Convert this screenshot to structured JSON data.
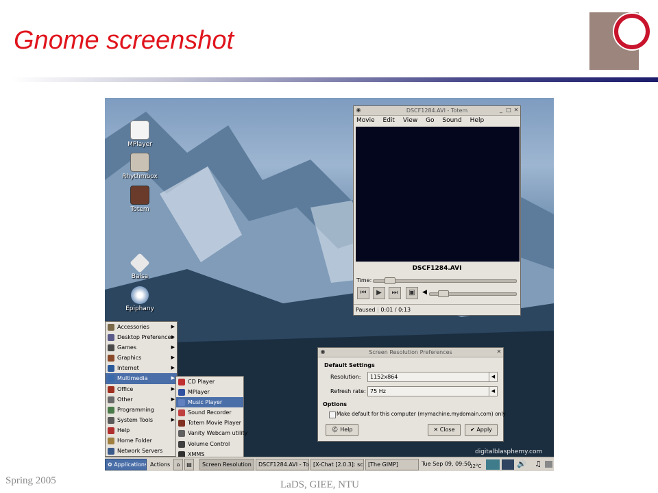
{
  "slide": {
    "title": "Gnome screenshot",
    "footer_left": "Spring 2005",
    "footer_center": "LaDS, GIEE, NTU",
    "accent_color": "#e0141c"
  },
  "desktop": {
    "watermark": "digitalblasphemy.com",
    "icons": [
      {
        "label": "MPlayer",
        "icon": "mplayer-icon"
      },
      {
        "label": "Rhythmbox",
        "icon": "rhythmbox-icon"
      },
      {
        "label": "Totem",
        "icon": "totem-icon"
      },
      {
        "label": "Balsa",
        "icon": "balsa-icon"
      },
      {
        "label": "Epiphany",
        "icon": "epiphany-icon"
      }
    ]
  },
  "totem": {
    "title": "DSCF1284.AVI - Totem",
    "menu": [
      "Movie",
      "Edit",
      "View",
      "Go",
      "Sound",
      "Help"
    ],
    "filename": "DSCF1284.AVI",
    "time_label": "Time:",
    "status": "Paused",
    "time": "0:01 / 0:13",
    "seek_fraction": 0.08,
    "volume_fraction": 0.1
  },
  "resolution_dialog": {
    "title": "Screen Resolution Preferences",
    "section_default": "Default Settings",
    "resolution_label": "Resolution:",
    "resolution_value": "1152x864",
    "refresh_label": "Refresh rate:",
    "refresh_value": "75 Hz",
    "section_options": "Options",
    "checkbox_label": "Make default for this computer (mymachine.mydomain.com) only",
    "help_label": "Help",
    "close_label": "Close",
    "apply_label": "Apply"
  },
  "app_menu": {
    "items": [
      {
        "label": "Accessories",
        "icon": "accessories-icon",
        "submenu": true
      },
      {
        "label": "Desktop Preferences",
        "icon": "desktop-preferences-icon",
        "submenu": true
      },
      {
        "label": "Games",
        "icon": "games-icon",
        "submenu": true
      },
      {
        "label": "Graphics",
        "icon": "graphics-icon",
        "submenu": true
      },
      {
        "label": "Internet",
        "icon": "internet-icon",
        "submenu": true
      },
      {
        "label": "Multimedia",
        "icon": "multimedia-icon",
        "submenu": true,
        "selected": true
      },
      {
        "label": "Office",
        "icon": "office-icon",
        "submenu": true
      },
      {
        "label": "Other",
        "icon": "other-icon",
        "submenu": true
      },
      {
        "label": "Programming",
        "icon": "programming-icon",
        "submenu": true
      },
      {
        "label": "System Tools",
        "icon": "system-tools-icon",
        "submenu": true
      },
      {
        "label": "Help",
        "icon": "help-icon",
        "submenu": false
      },
      {
        "label": "Home Folder",
        "icon": "home-folder-icon",
        "submenu": false
      },
      {
        "label": "Network Servers",
        "icon": "network-servers-icon",
        "submenu": false
      }
    ]
  },
  "multimedia_menu": {
    "items": [
      {
        "label": "CD Player",
        "icon": "cd-player-icon"
      },
      {
        "label": "MPlayer",
        "icon": "mplayer-icon"
      },
      {
        "label": "Music Player",
        "icon": "music-player-icon",
        "selected": true
      },
      {
        "label": "Sound Recorder",
        "icon": "sound-recorder-icon"
      },
      {
        "label": "Totem Movie Player",
        "icon": "totem-icon"
      },
      {
        "label": "Vanity Webcam utility",
        "icon": "webcam-icon"
      },
      {
        "label": "Volume Control",
        "icon": "volume-icon"
      },
      {
        "label": "XMMS",
        "icon": "xmms-icon"
      }
    ]
  },
  "panel": {
    "applications": "Applications",
    "actions": "Actions",
    "tasks": [
      "Screen Resolution",
      "DSCF1284.AVI - To",
      "[X-Chat [2.0.3]: sc",
      "[The GIMP]"
    ],
    "clock": "Tue Sep 09, 09:50",
    "temperature": "12°C"
  },
  "colors": {
    "selection": "#4a6ea8",
    "window_bg": "#e6e2dc",
    "video_bg": "#04061e"
  }
}
